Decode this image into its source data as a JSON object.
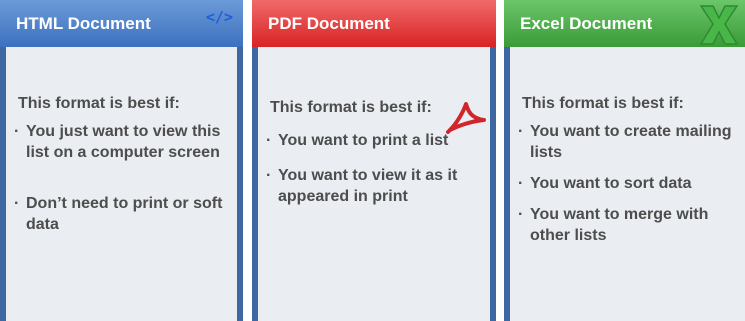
{
  "cards": [
    {
      "title": "HTML Document",
      "icon": "code-icon",
      "icon_text": "</>",
      "intro": "This format is best if:",
      "items": [
        "You just want to view this list on a computer screen",
        "Don’t need to print or soft data"
      ],
      "color": "#3d71bf"
    },
    {
      "title": "PDF Document",
      "icon": "acrobat-icon",
      "intro": "This format is best if:",
      "items": [
        "You want to print a list",
        "You want to view it as it appeared in print"
      ],
      "color": "#d92324"
    },
    {
      "title": "Excel Document",
      "icon": "excel-icon",
      "intro": "This format is best if:",
      "items": [
        "You want to create mailing lists",
        "You want to sort data",
        "You want to merge with other lists"
      ],
      "color": "#3a9b37"
    }
  ],
  "bullet": "·",
  "colors": {
    "card_background": "#eaedf2",
    "border": "#3f68a3",
    "text": "#4d4d4d"
  }
}
